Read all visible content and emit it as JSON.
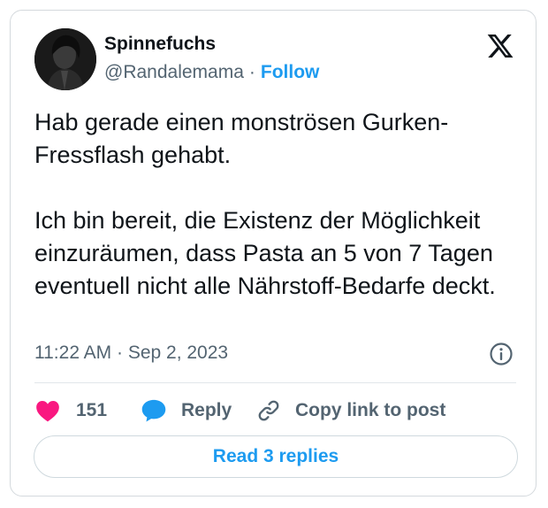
{
  "author": {
    "display_name": "Spinnefuchs",
    "handle": "@Randalemama",
    "separator": "·",
    "follow_label": "Follow"
  },
  "tweet": {
    "paragraphs": [
      "Hab gerade einen monströsen Gurken-Fressflash gehabt.",
      "Ich bin bereit, die Existenz der Möglichkeit einzuräumen, dass Pasta an 5 von 7 Tagen eventuell nicht alle Nährstoff-Bedarfe deckt."
    ],
    "timestamp": "11:22 AM · Sep 2, 2023"
  },
  "actions": {
    "like_count": "151",
    "reply_label": "Reply",
    "copy_link_label": "Copy link to post"
  },
  "read_replies_label": "Read 3 replies",
  "icons": {
    "brand": "x-logo-icon",
    "info": "info-icon",
    "like": "heart-icon",
    "reply": "speech-bubble-icon",
    "copy": "link-icon"
  },
  "colors": {
    "accent": "#1d9bf0",
    "like": "#f91880",
    "text_primary": "#0f1419",
    "text_secondary": "#536471",
    "border": "#cfd9de"
  }
}
